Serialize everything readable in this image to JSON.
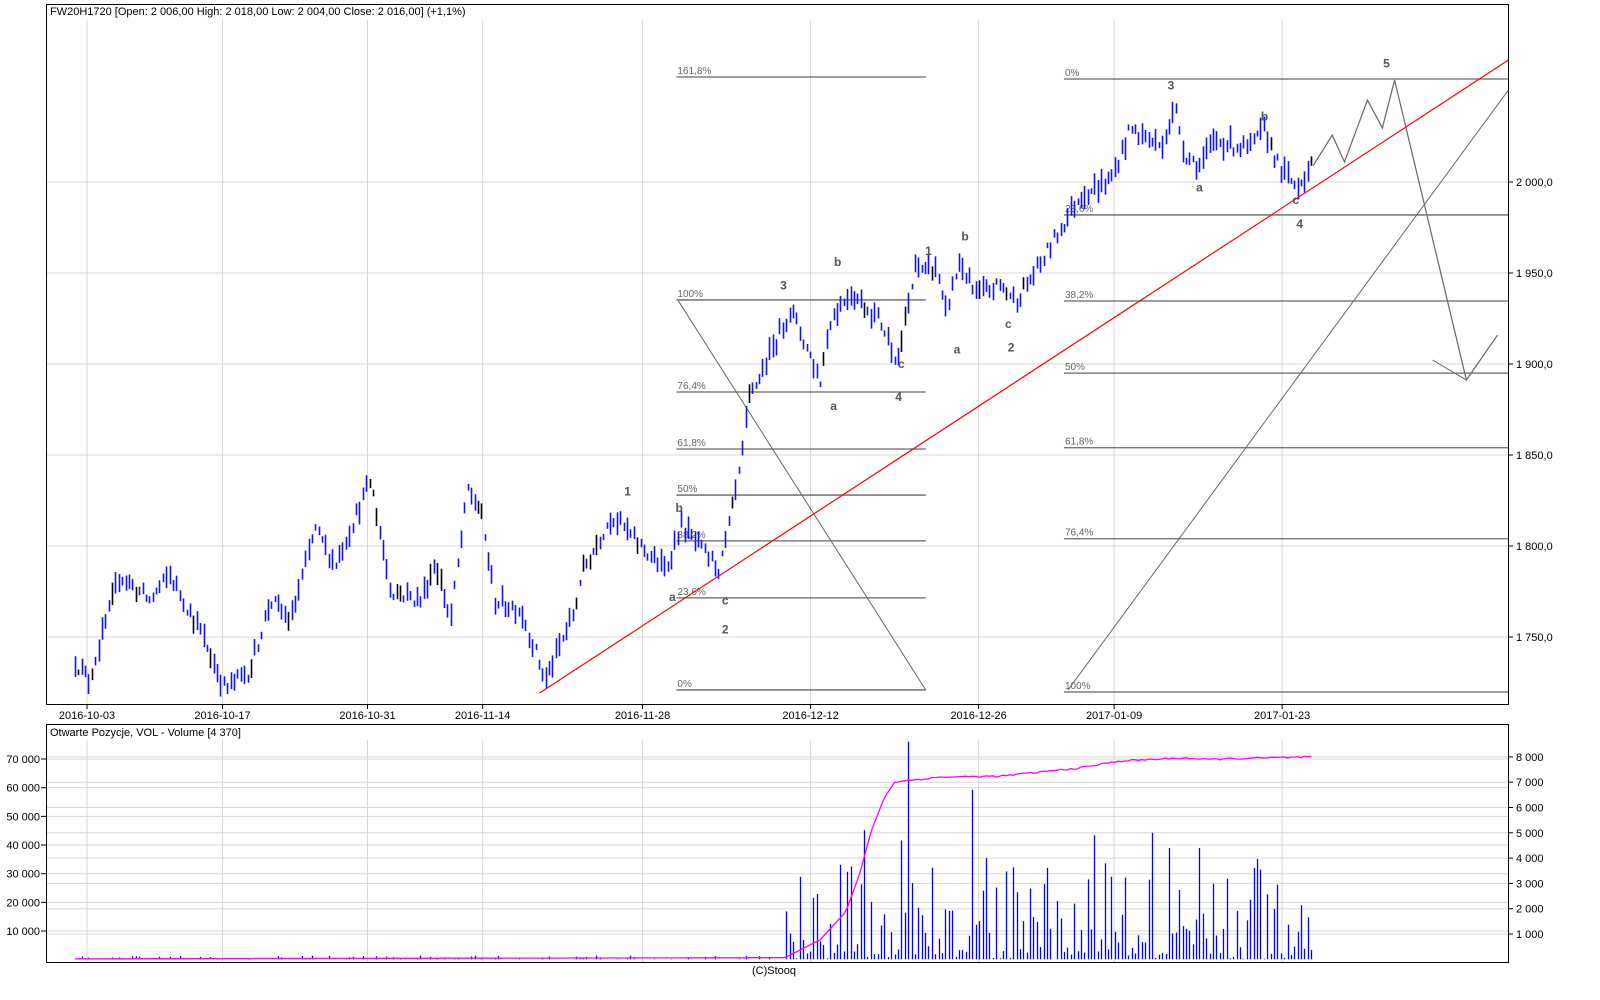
{
  "header": {
    "price_title": "FW20H1720 [Open: 2 006,00  High: 2 018,00  Low: 2 004,00  Close: 2 016,00] (+1,1%)",
    "volume_title": "Otwarte Pozycje, VOL - Volume [4 370]",
    "copyright": "(C)Stooq"
  },
  "colors": {
    "bars": "#1010ff",
    "bars_down": "#000000",
    "trendline": "#ff0000",
    "fib": "#666666",
    "open_interest": "#ff00ff",
    "volume": "#0000ff",
    "grid": "#d8d8d8"
  },
  "chart_data": [
    {
      "type": "ohlc",
      "title": "FW20H1720",
      "x_unit": "trading session index (0 = 2016-10-03)",
      "x_ticks": [
        {
          "idx": 0,
          "label": "2016-10-03"
        },
        {
          "idx": 10,
          "label": "2016-10-17"
        },
        {
          "idx": 20.7,
          "label": "2016-10-31"
        },
        {
          "idx": 29.2,
          "label": "2016-11-14"
        },
        {
          "idx": 41.0,
          "label": "2016-11-28"
        },
        {
          "idx": 53.4,
          "label": "2016-12-12"
        },
        {
          "idx": 65.8,
          "label": "2016-12-26"
        },
        {
          "idx": 75.8,
          "label": "2017-01-09"
        },
        {
          "idx": 88.2,
          "label": "2017-01-23"
        }
      ],
      "xlim": [
        -3,
        104.9
      ],
      "ylim": [
        1713,
        2098
      ],
      "y_ticks": [
        {
          "value": 1750,
          "label": "1 750,0"
        },
        {
          "value": 1800,
          "label": "1 800,0"
        },
        {
          "value": 1850,
          "label": "1 850,0"
        },
        {
          "value": 1900,
          "label": "1 900,0"
        },
        {
          "value": 1950,
          "label": "1 950,0"
        },
        {
          "value": 2000,
          "label": "2 000,0"
        }
      ],
      "bars_per_session": 4,
      "price_path": [
        [
          -0.9,
          1737
        ],
        [
          0.1,
          1726
        ],
        [
          2.4,
          1784
        ],
        [
          4.6,
          1770
        ],
        [
          6.1,
          1784
        ],
        [
          8.3,
          1754
        ],
        [
          10.2,
          1721
        ],
        [
          12.0,
          1732
        ],
        [
          13.5,
          1770
        ],
        [
          15.0,
          1759
        ],
        [
          16.8,
          1809
        ],
        [
          18.3,
          1790
        ],
        [
          20.9,
          1836
        ],
        [
          22.4,
          1776
        ],
        [
          24.6,
          1770
        ],
        [
          25.7,
          1792
        ],
        [
          26.8,
          1759
        ],
        [
          28.1,
          1831
        ],
        [
          29.0,
          1820
        ],
        [
          30.1,
          1770
        ],
        [
          32.0,
          1765
        ],
        [
          33.8,
          1726
        ],
        [
          36.0,
          1765
        ],
        [
          36.4,
          1784
        ],
        [
          38.7,
          1817
        ],
        [
          40.8,
          1800
        ],
        [
          42.7,
          1787
        ],
        [
          43.8,
          1812
        ],
        [
          45.3,
          1798
        ],
        [
          46.7,
          1787
        ],
        [
          48.2,
          1842
        ],
        [
          48.8,
          1880
        ],
        [
          51.9,
          1930
        ],
        [
          54.1,
          1891
        ],
        [
          54.8,
          1924
        ],
        [
          56.3,
          1940
        ],
        [
          58.5,
          1924
        ],
        [
          59.8,
          1902
        ],
        [
          61.1,
          1952
        ],
        [
          62.6,
          1954
        ],
        [
          63.3,
          1927
        ],
        [
          64.4,
          1957
        ],
        [
          65.5,
          1938
        ],
        [
          67.4,
          1943
        ],
        [
          68.5,
          1935
        ],
        [
          70.3,
          1954
        ],
        [
          71.1,
          1965
        ],
        [
          73.3,
          1993
        ],
        [
          75.5,
          2001
        ],
        [
          77.0,
          2029
        ],
        [
          79.2,
          2020
        ],
        [
          80.3,
          2040
        ],
        [
          81.0,
          2015
        ],
        [
          82.1,
          2009
        ],
        [
          83.2,
          2023
        ],
        [
          85.8,
          2018
        ],
        [
          86.9,
          2029
        ],
        [
          88.0,
          2007
        ],
        [
          89.2,
          1998
        ],
        [
          90.5,
          2009
        ]
      ],
      "trendline": [
        [
          33.4,
          1719.2
        ],
        [
          104.9,
          2067
        ]
      ],
      "fib_sets": [
        {
          "x_range": [
            43.5,
            61.9
          ],
          "diagonal": [
            [
              43.6,
              1935.2
            ],
            [
              61.9,
              1720.9
            ]
          ],
          "levels": [
            {
              "label": "161,8%",
              "value": 2057.7
            },
            {
              "label": "100%",
              "value": 1935.2
            },
            {
              "label": "76,4%",
              "value": 1884.6
            },
            {
              "label": "61,8%",
              "value": 1853.3
            },
            {
              "label": "50%",
              "value": 1828.0
            },
            {
              "label": "38,2%",
              "value": 1802.8
            },
            {
              "label": "23,6%",
              "value": 1771.5
            },
            {
              "label": "0%",
              "value": 1720.9
            }
          ]
        },
        {
          "x_range": [
            72.1,
            104.9
          ],
          "diagonal": [
            [
              72.4,
              1720.9
            ],
            [
              104.9,
              2050.5
            ]
          ],
          "levels": [
            {
              "label": "0%",
              "value": 2056.6
            },
            {
              "label": "23,6%",
              "value": 1981.9
            },
            {
              "label": "38,2%",
              "value": 1934.6
            },
            {
              "label": "50%",
              "value": 1895.0
            },
            {
              "label": "61,8%",
              "value": 1854.0
            },
            {
              "label": "76,4%",
              "value": 1804.0
            },
            {
              "label": "100%",
              "value": 1719.8
            }
          ]
        }
      ],
      "projection": [
        [
          90.5,
          2009
        ],
        [
          91.9,
          2025.8
        ],
        [
          92.8,
          2011
        ],
        [
          94.5,
          2045
        ],
        [
          95.6,
          2029.7
        ],
        [
          96.5,
          2056
        ],
        [
          101.8,
          1891.2
        ],
        [
          104.1,
          1915.9
        ]
      ],
      "projection_extra": [
        [
          99.3,
          1902.2
        ],
        [
          101.8,
          1891.2
        ]
      ],
      "wave_labels": [
        {
          "idx": 39.9,
          "price": 1830,
          "text": "1"
        },
        {
          "idx": 43.7,
          "price": 1821,
          "text": "b"
        },
        {
          "idx": 43.2,
          "price": 1772,
          "text": "a"
        },
        {
          "idx": 47.1,
          "price": 1770,
          "text": "c"
        },
        {
          "idx": 47.1,
          "price": 1754,
          "text": "2"
        },
        {
          "idx": 51.4,
          "price": 1943,
          "text": "3"
        },
        {
          "idx": 55.4,
          "price": 1956,
          "text": "b"
        },
        {
          "idx": 55.1,
          "price": 1877,
          "text": "a"
        },
        {
          "idx": 60.1,
          "price": 1900,
          "text": "c"
        },
        {
          "idx": 59.9,
          "price": 1882,
          "text": "4"
        },
        {
          "idx": 62.1,
          "price": 1962,
          "text": "1"
        },
        {
          "idx": 64.8,
          "price": 1970,
          "text": "b"
        },
        {
          "idx": 64.2,
          "price": 1908,
          "text": "a"
        },
        {
          "idx": 68.0,
          "price": 1922,
          "text": "c"
        },
        {
          "idx": 68.2,
          "price": 1909,
          "text": "2"
        },
        {
          "idx": 80.0,
          "price": 2053,
          "text": "3"
        },
        {
          "idx": 82.1,
          "price": 1997,
          "text": "a"
        },
        {
          "idx": 86.9,
          "price": 2036,
          "text": "b"
        },
        {
          "idx": 89.2,
          "price": 1990,
          "text": "c"
        },
        {
          "idx": 89.5,
          "price": 1977,
          "text": "4"
        },
        {
          "idx": 95.9,
          "price": 2065,
          "text": "5"
        }
      ]
    },
    {
      "type": "bar+line",
      "title": "Otwarte Pozycje, VOL - Volume",
      "left_axis": {
        "name": "Open interest",
        "ylim": [
          0,
          82000
        ],
        "ticks": [
          {
            "value": 10000,
            "label": "10 000"
          },
          {
            "value": 20000,
            "label": "20 000"
          },
          {
            "value": 30000,
            "label": "30 000"
          },
          {
            "value": 40000,
            "label": "40 000"
          },
          {
            "value": 50000,
            "label": "50 000"
          },
          {
            "value": 60000,
            "label": "60 000"
          },
          {
            "value": 70000,
            "label": "70 000"
          }
        ]
      },
      "right_axis": {
        "name": "Volume",
        "ylim": [
          0,
          9300
        ],
        "ticks": [
          {
            "value": 1000,
            "label": "1 000"
          },
          {
            "value": 2000,
            "label": "2 000"
          },
          {
            "value": 3000,
            "label": "3 000"
          },
          {
            "value": 4000,
            "label": "4 000"
          },
          {
            "value": 5000,
            "label": "5 000"
          },
          {
            "value": 6000,
            "label": "6 000"
          },
          {
            "value": 7000,
            "label": "7 000"
          },
          {
            "value": 8000,
            "label": "8 000"
          }
        ]
      },
      "open_interest": [
        [
          -0.9,
          300
        ],
        [
          51.5,
          700
        ],
        [
          54.1,
          6900
        ],
        [
          56.0,
          16700
        ],
        [
          57.0,
          29600
        ],
        [
          57.9,
          45300
        ],
        [
          58.9,
          57000
        ],
        [
          59.6,
          62000
        ],
        [
          63.0,
          63700
        ],
        [
          67.4,
          64000
        ],
        [
          73.3,
          66900
        ],
        [
          76.2,
          69300
        ],
        [
          81.0,
          70400
        ],
        [
          82.5,
          69800
        ],
        [
          85.0,
          70200
        ],
        [
          90.5,
          70700
        ]
      ],
      "volume_last": 4370,
      "volume_spikes": [
        [
          60.4,
          8600
        ],
        [
          65.3,
          6700
        ],
        [
          57.3,
          5100
        ],
        [
          60.1,
          4700
        ],
        [
          74.3,
          4900
        ],
        [
          78.6,
          5000
        ],
        [
          79.8,
          4400
        ],
        [
          82.0,
          4400
        ],
        [
          90.5,
          4370
        ]
      ]
    }
  ]
}
